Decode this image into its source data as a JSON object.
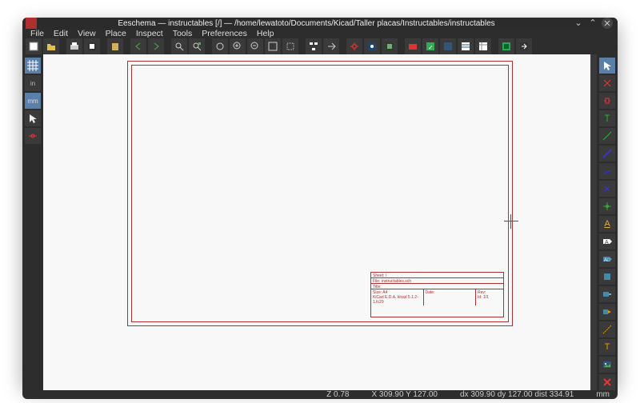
{
  "title": "Eeschema — instructables [/] — /home/lewatoto/Documents/Kicad/Taller placas/Instructables/instructables",
  "menu": {
    "file": "File",
    "edit": "Edit",
    "view": "View",
    "place": "Place",
    "inspect": "Inspect",
    "tools": "Tools",
    "preferences": "Preferences",
    "help": "Help"
  },
  "titleblock": {
    "sheet": "Sheet: /",
    "file": "File: instructables.sch",
    "title": "Title:",
    "size": "Size: A4",
    "date": "Date:",
    "rev": "Rev:",
    "kicad": "KiCad E.D.A.  kicad 5.1.2-1.fc29",
    "id": "Id: 1/1"
  },
  "status": {
    "zoom": "Z 0.78",
    "xy": "X 309.90  Y 127.00",
    "dxy": "dx 309.90  dy 127.00  dist 334.91",
    "unit": "mm"
  },
  "left_tools": {
    "grid": "grid",
    "unit_in": "in",
    "unit_mm": "mm",
    "cursor": "cursor",
    "hidden_pins": "pins"
  },
  "right_tools": {
    "select": "select",
    "highlight": "highlight",
    "component": "component",
    "power": "power",
    "wire": "wire",
    "bus": "bus",
    "bus_entry": "bus-entry",
    "noconnect": "noconnect",
    "junction": "junction",
    "label": "label",
    "global_label": "global-label",
    "hier_label": "hier-label",
    "sheet": "sheet",
    "import_pin": "import-pin",
    "line": "line",
    "text": "text",
    "image": "image",
    "delete": "delete"
  }
}
